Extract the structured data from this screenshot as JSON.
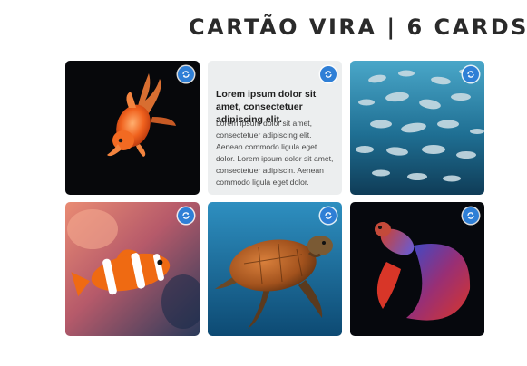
{
  "page": {
    "title": "CARTÃO VIRA | 6 CARDS"
  },
  "cards": [
    {
      "type": "image",
      "subject": "goldfish",
      "flip_icon": "flip-icon"
    },
    {
      "type": "text",
      "heading": "Lorem ipsum dolor sit amet, consectetuer adipiscing elit.",
      "body": "Lorem ipsum dolor sit amet, consectetuer adipiscing elit. Aenean commodo ligula eget dolor. Lorem ipsum dolor sit amet, consectetuer adipiscin. Aenean commodo ligula eget dolor.",
      "flip_icon": "flip-icon"
    },
    {
      "type": "image",
      "subject": "school-of-fish",
      "flip_icon": "flip-icon"
    },
    {
      "type": "image",
      "subject": "clownfish",
      "flip_icon": "flip-icon"
    },
    {
      "type": "image",
      "subject": "sea-turtle",
      "flip_icon": "flip-icon"
    },
    {
      "type": "image",
      "subject": "betta-fish",
      "flip_icon": "flip-icon"
    }
  ],
  "colors": {
    "flip_button": "#2f7fd6",
    "text_card_bg": "#eceeef",
    "title": "#2a2a2a"
  }
}
